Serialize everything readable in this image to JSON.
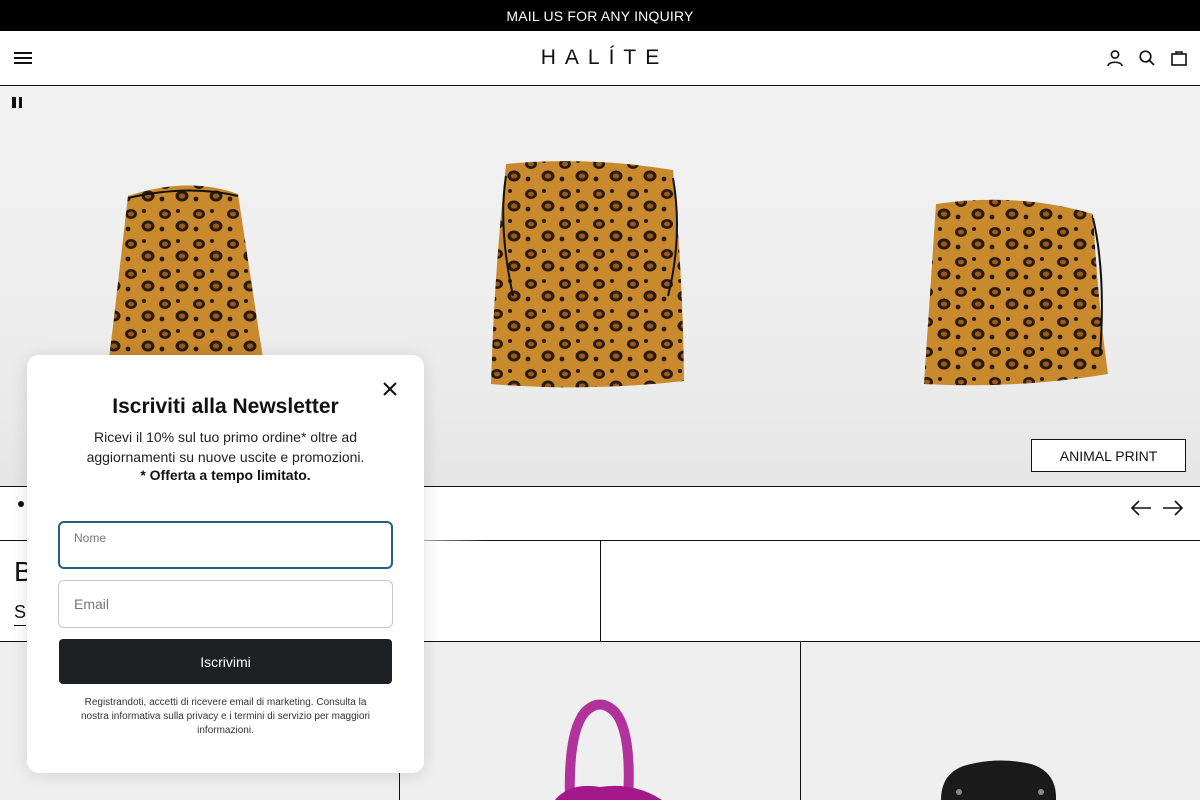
{
  "announcement": {
    "text": "MAIL US FOR ANY INQUIRY"
  },
  "header": {
    "logo": "HALÍTE",
    "icons": [
      "menu-icon",
      "account-icon",
      "search-icon",
      "cart-icon"
    ]
  },
  "hero": {
    "button_label": "ANIMAL PRINT",
    "icons": [
      "pause-icon",
      "arrow-left-icon",
      "arrow-right-icon"
    ]
  },
  "intro": {
    "title": "B",
    "link": "S"
  },
  "newsletter": {
    "title": "Iscriviti alla Newsletter",
    "text": "Ricevi il 10% sul tuo primo ordine* oltre ad aggiornamenti su nuove uscite e promozioni.",
    "offer": "* Offerta a tempo limitato.",
    "name_label": "Nome",
    "email_placeholder": "Email",
    "submit_label": "Iscrivimi",
    "legal": "Registrandoti, accetti di ricevere email di marketing. Consulta la nostra informativa sulla privacy e i termini di servizio per maggiori informazioni."
  },
  "colors": {
    "announcement_bg": "#000000",
    "button_dark": "#1f2023",
    "focus_border": "#23627a"
  }
}
